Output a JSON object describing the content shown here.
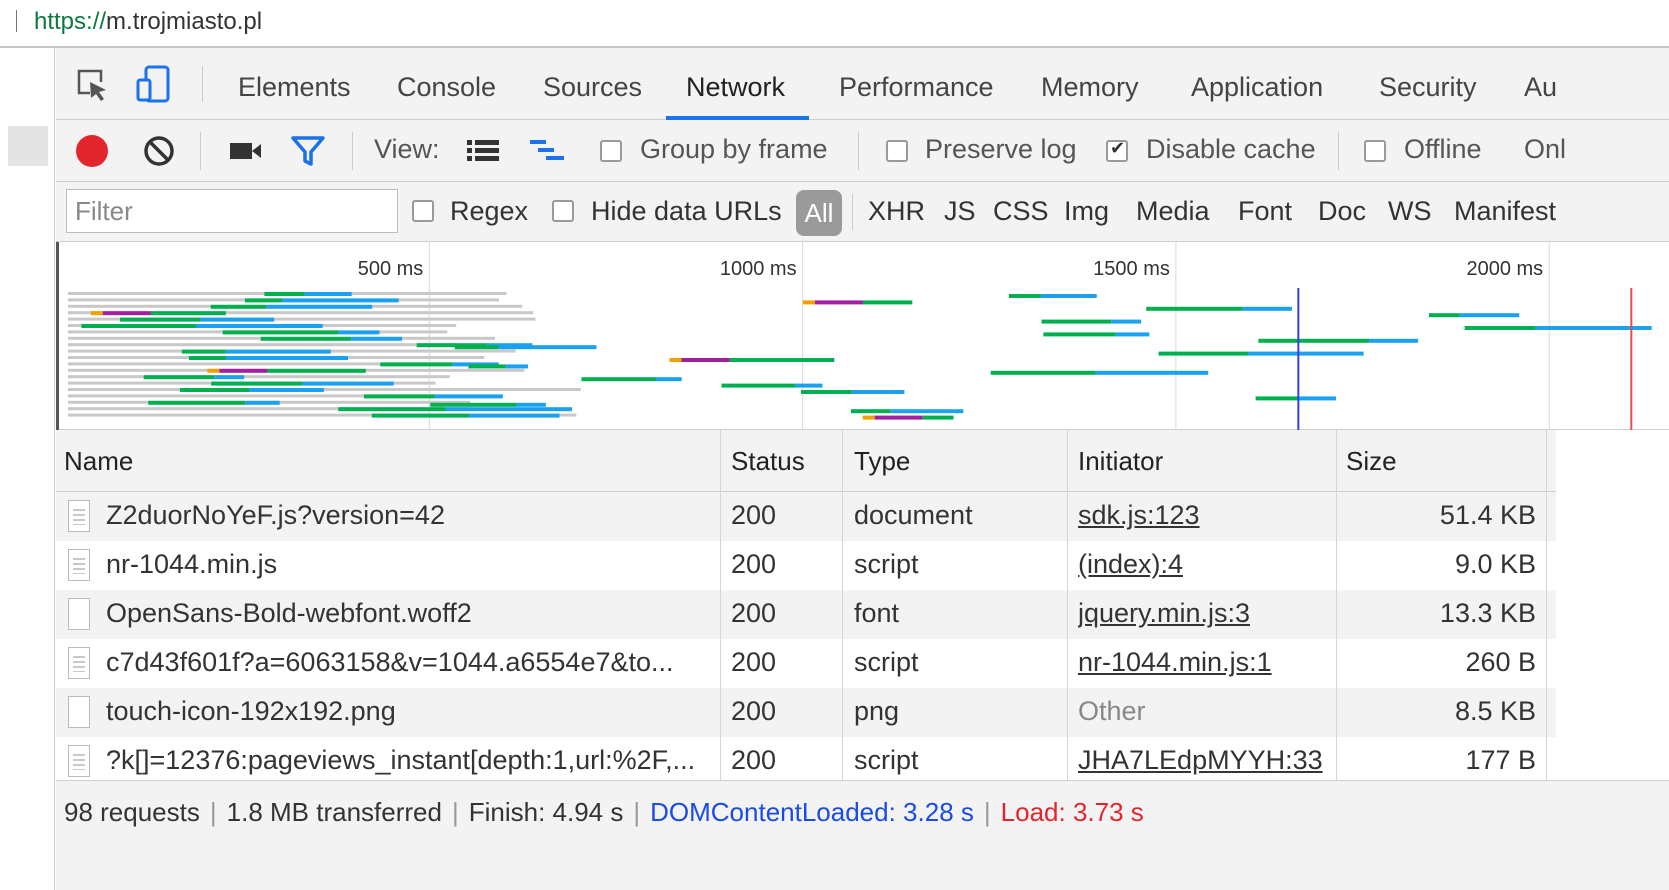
{
  "url_bar": {
    "scheme": "https://",
    "host": "m.trojmiasto.pl"
  },
  "tabs": [
    {
      "label": "Elements"
    },
    {
      "label": "Console"
    },
    {
      "label": "Sources"
    },
    {
      "label": "Network",
      "active": true
    },
    {
      "label": "Performance"
    },
    {
      "label": "Memory"
    },
    {
      "label": "Application"
    },
    {
      "label": "Security"
    },
    {
      "label": "Au"
    }
  ],
  "toolbar": {
    "view_label": "View:",
    "group_by_frame": {
      "label": "Group by frame",
      "checked": false
    },
    "preserve_log": {
      "label": "Preserve log",
      "checked": false
    },
    "disable_cache": {
      "label": "Disable cache",
      "checked": true
    },
    "offline": {
      "label": "Offline",
      "checked": false
    },
    "online_partial": "Onl"
  },
  "filterbar": {
    "filter_placeholder": "Filter",
    "regex": {
      "label": "Regex",
      "checked": false
    },
    "hide_data_urls": {
      "label": "Hide data URLs",
      "checked": false
    },
    "all_label": "All",
    "types": [
      "XHR",
      "JS",
      "CSS",
      "Img",
      "Media",
      "Font",
      "Doc",
      "WS",
      "Manifest"
    ]
  },
  "overview": {
    "ticks": [
      {
        "label": "500 ms",
        "ms": 500
      },
      {
        "label": "1000 ms",
        "ms": 1000
      },
      {
        "label": "1500 ms",
        "ms": 1500
      },
      {
        "label": "2000 ms",
        "ms": 2000
      }
    ],
    "dom_content_loaded_ms": 1664,
    "load_ms": 2110,
    "colors": {
      "waiting": "#00b050",
      "download": "#1aa1f0",
      "queue": "#c8c8c8",
      "ssl": "#a020a0",
      "connect": "#f0a000",
      "dcl_line": "#3a3ae8",
      "load_line": "#e05050"
    }
  },
  "table": {
    "columns": [
      "Name",
      "Status",
      "Type",
      "Initiator",
      "Size"
    ],
    "rows": [
      {
        "icon": "js-file-icon",
        "name": "Z2duorNoYeF.js?version=42",
        "status": "200",
        "type": "document",
        "initiator": "sdk.js:123",
        "initiator_link": true,
        "size": "51.4 KB"
      },
      {
        "icon": "js-file-icon",
        "name": "nr-1044.min.js",
        "status": "200",
        "type": "script",
        "initiator": "(index):4",
        "initiator_link": true,
        "size": "9.0 KB"
      },
      {
        "icon": "blank-file-icon",
        "name": "OpenSans-Bold-webfont.woff2",
        "status": "200",
        "type": "font",
        "initiator": "jquery.min.js:3",
        "initiator_link": true,
        "size": "13.3 KB"
      },
      {
        "icon": "js-file-icon",
        "name": "c7d43f601f?a=6063158&v=1044.a6554e7&to...",
        "status": "200",
        "type": "script",
        "initiator": "nr-1044.min.js:1",
        "initiator_link": true,
        "size": "260 B"
      },
      {
        "icon": "blank-file-icon",
        "name": "touch-icon-192x192.png",
        "status": "200",
        "type": "png",
        "initiator": "Other",
        "initiator_link": false,
        "size": "8.5 KB"
      },
      {
        "icon": "js-file-icon",
        "name": "?k[]=12376:pageviews_instant[depth:1,url:%2F,...",
        "status": "200",
        "type": "script",
        "initiator": "JHA7LEdpMYYH:33",
        "initiator_link": true,
        "size": "177 B"
      }
    ]
  },
  "status_bar": {
    "requests": "98 requests",
    "transferred": "1.8 MB transferred",
    "finish": "Finish: 4.94 s",
    "dcl": "DOMContentLoaded: 3.28 s",
    "load": "Load: 3.73 s"
  }
}
